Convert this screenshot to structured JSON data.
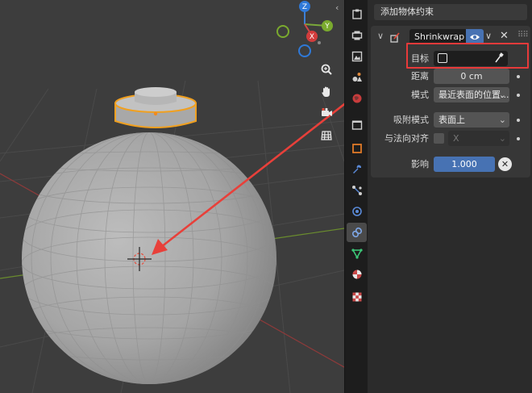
{
  "viewport": {
    "gizmo_axes": {
      "z": "Z",
      "y": "Y",
      "x": "X"
    },
    "tools": [
      "zoom-icon",
      "hand-pan-icon",
      "camera-icon",
      "grid-icon"
    ],
    "colors": {
      "background": "#3d3d3d",
      "selection_outline": "#f0a020",
      "annotation_arrow": "#e8403a",
      "x_axis": "#9b3a3a",
      "y_axis": "#6a8c2e"
    }
  },
  "tabs": [
    {
      "name": "tool-icon",
      "active": false
    },
    {
      "name": "render-icon",
      "active": false
    },
    {
      "name": "output-icon",
      "active": false
    },
    {
      "name": "view-layer-icon",
      "active": false
    },
    {
      "name": "scene-icon",
      "active": false
    },
    {
      "name": "world-icon",
      "active": false
    },
    {
      "name": "collection-icon",
      "active": false
    },
    {
      "name": "object-icon",
      "active": false
    },
    {
      "name": "modifier-icon",
      "active": false
    },
    {
      "name": "particles-icon",
      "active": false
    },
    {
      "name": "physics-icon",
      "active": false
    },
    {
      "name": "constraint-icon",
      "active": true
    },
    {
      "name": "data-icon",
      "active": false
    },
    {
      "name": "material-icon",
      "active": false
    },
    {
      "name": "texture-icon",
      "active": false
    }
  ],
  "panel": {
    "add_constraint_label": "添加物体约束",
    "constraint": {
      "name": "Shrinkwrap",
      "target_label": "目标",
      "distance_label": "距离",
      "distance_value": "0 cm",
      "mode_label": "模式",
      "mode_value": "最近表面的位置...",
      "snap_label": "吸附模式",
      "snap_value": "表面上",
      "align_label": "与法向对齐",
      "align_axis": "X",
      "influence_label": "影响",
      "influence_value": "1.000"
    }
  }
}
